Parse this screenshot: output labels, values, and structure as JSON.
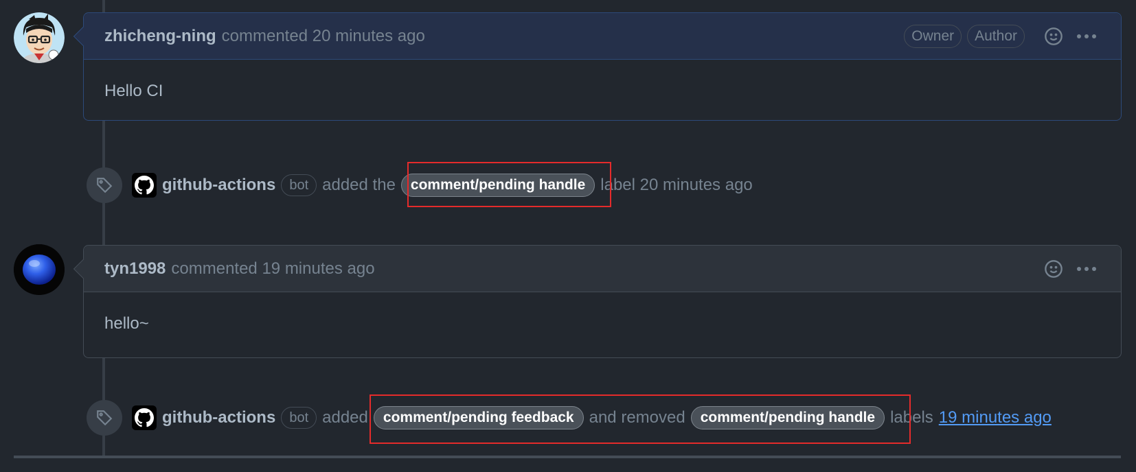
{
  "comments": [
    {
      "author": "zhicheng-ning",
      "meta": "commented 20 minutes ago",
      "badges": [
        "Owner",
        "Author"
      ],
      "body": "Hello CI"
    },
    {
      "author": "tyn1998",
      "meta": "commented 19 minutes ago",
      "body": "hello~"
    }
  ],
  "events": [
    {
      "actor": "github-actions",
      "bot_badge": "bot",
      "text_before": "added the",
      "label": "comment/pending handle",
      "text_after": "label 20 minutes ago"
    },
    {
      "actor": "github-actions",
      "bot_badge": "bot",
      "text_added": "added",
      "label_added": "comment/pending feedback",
      "text_removed": "and removed",
      "label_removed": "comment/pending handle",
      "text_labels": "labels",
      "time_link": "19 minutes ago"
    }
  ],
  "colors": {
    "background": "#22272e",
    "owner_header": "#25304a",
    "label_chip": "#4a5159",
    "link": "#539bf5",
    "highlight": "#e52b2b"
  },
  "icons": {
    "comment_actions": [
      "smiley-icon",
      "kebab-horizontal-icon"
    ],
    "event_icon": "tag-icon",
    "actor_avatar": "github-mark-icon"
  }
}
